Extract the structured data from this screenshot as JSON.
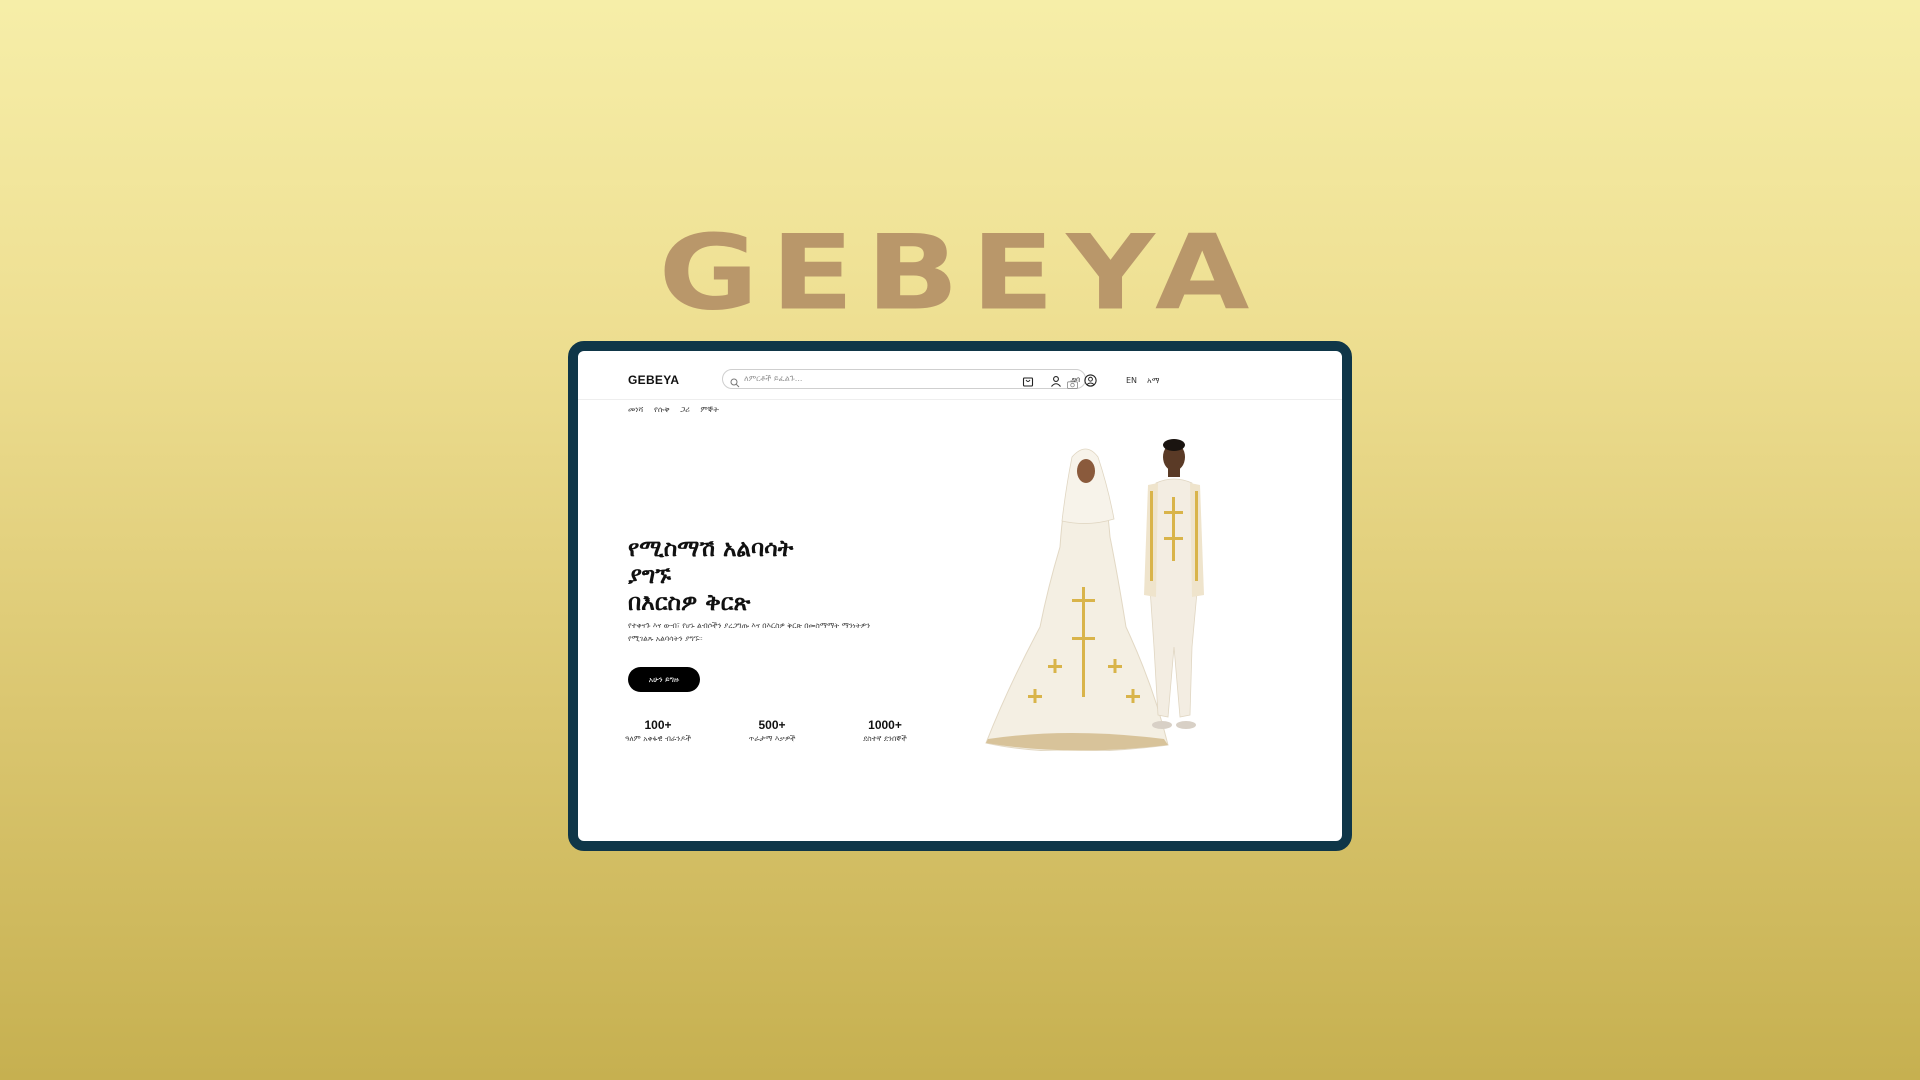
{
  "hero_logo": "GEBEYA",
  "header": {
    "brand": "GEBEYA",
    "search_placeholder": "ለምርቶች ይፈልጉ...",
    "login_label": "ግባ",
    "languages": [
      "EN",
      "አማ"
    ]
  },
  "subnav": [
    "መነሻ",
    "የሱቅ",
    "ጋሪ",
    "ምኞት"
  ],
  "hero": {
    "headline_lines": [
      "የሚስማሽ አልባሳት",
      "ያግኙ",
      "በእርስዎ ቅርጽ"
    ],
    "subtext": "የተቀናጉ እና ውብ፣ የሆኑ ልብሶችን ያረጋግጡ እና በእርስዎ ቅርጽ በመስማማት ማንነትዎን የሚገልጹ አልባሳትን ያግኙ።",
    "cta": "አሁን ይግዙ"
  },
  "stats": [
    {
      "value": "100+",
      "label": "ዓለም አቀፋዊ ብራንዶች"
    },
    {
      "value": "500+",
      "label": "ጥራታማ እቃዎች"
    },
    {
      "value": "1000+",
      "label": "ደስተኛ ደንበኞች"
    }
  ],
  "icons": {
    "search": "search-icon",
    "camera": "camera-icon",
    "cart": "shopping-bag-icon",
    "user": "user-icon",
    "account": "account-circle-icon"
  },
  "colors": {
    "frame": "#0f3648",
    "logo": "#b9976a",
    "cta_bg": "#000000",
    "embroidery": "#d9b44a"
  }
}
